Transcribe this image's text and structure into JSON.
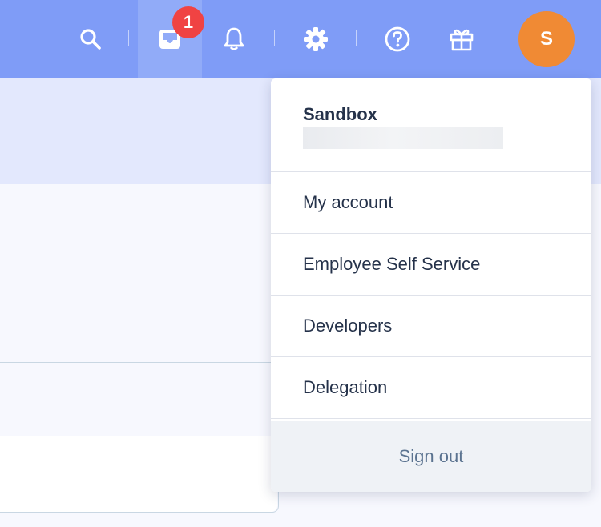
{
  "topbar": {
    "icons": [
      "search-icon",
      "inbox-icon",
      "bell-icon",
      "gear-icon",
      "help-icon",
      "gift-icon"
    ],
    "inbox_badge": "1",
    "avatar_initial": "S",
    "colors": {
      "bar": "#7f9cf7",
      "badge": "#f04343",
      "avatar": "#f08a34"
    }
  },
  "account_menu": {
    "org_name": "Sandbox",
    "items": [
      {
        "label": "My account"
      },
      {
        "label": "Employee Self Service"
      },
      {
        "label": "Developers"
      },
      {
        "label": "Delegation"
      }
    ],
    "sign_out": "Sign out"
  }
}
